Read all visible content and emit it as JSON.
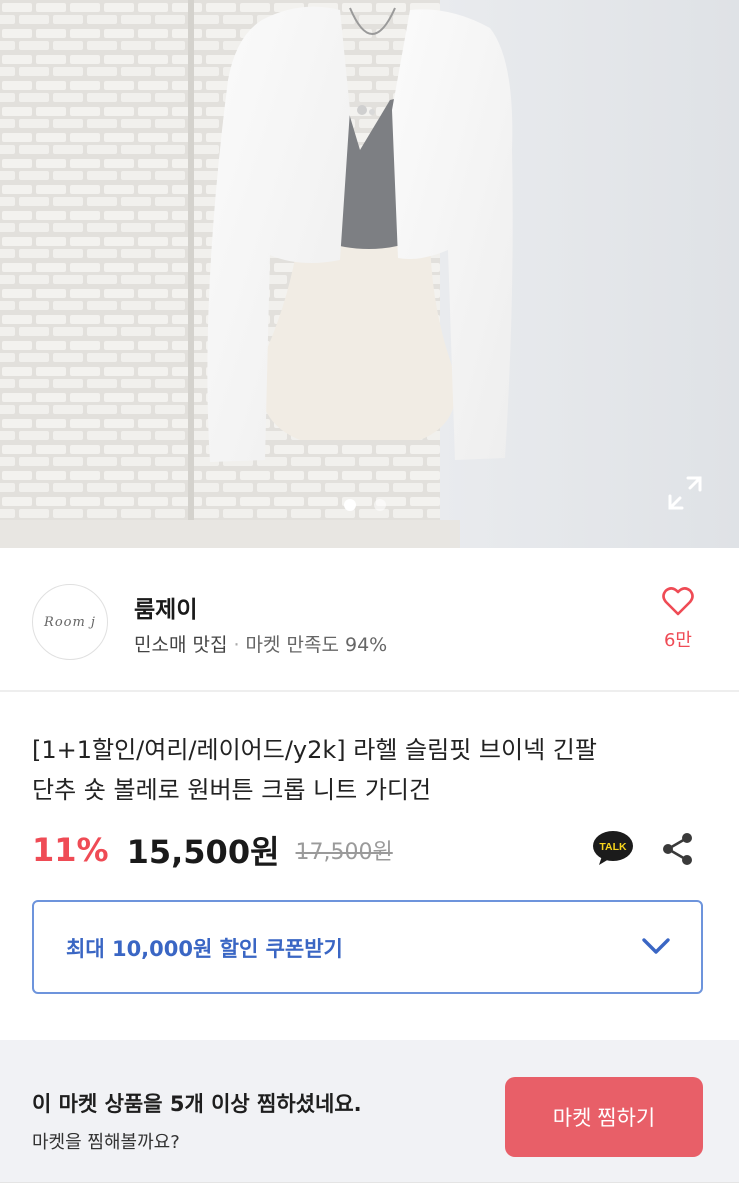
{
  "shop": {
    "logo_text": "Room j",
    "name": "룸제이",
    "tag": "민소매 맛집",
    "separator": "·",
    "satisfaction": "마켓 만족도 94%",
    "like_count": "6만"
  },
  "product": {
    "title_line1": "[1+1할인/여리/레이어드/y2k] 라헬 슬림핏 브이넥 긴팔",
    "title_line2": "단추 숏 볼레로 원버튼 크롭 니트 가디건",
    "discount": "11%",
    "price": "15,500원",
    "original_price": "17,500원"
  },
  "gallery": {
    "slide_count": 2,
    "active_index": 0
  },
  "actions": {
    "talk_label": "TALK"
  },
  "coupon": {
    "label": "최대 10,000원 할인 쿠폰받기"
  },
  "banner": {
    "main": "이 마켓 상품을 5개 이상 찜하셨네요.",
    "sub": "마켓을 찜해볼까요?",
    "button": "마켓 찜하기"
  },
  "colors": {
    "accent_red": "#ef4b55",
    "coupon_blue": "#3a66c4",
    "button_red": "#e85f68",
    "talk_yellow": "#1b1b1b"
  }
}
